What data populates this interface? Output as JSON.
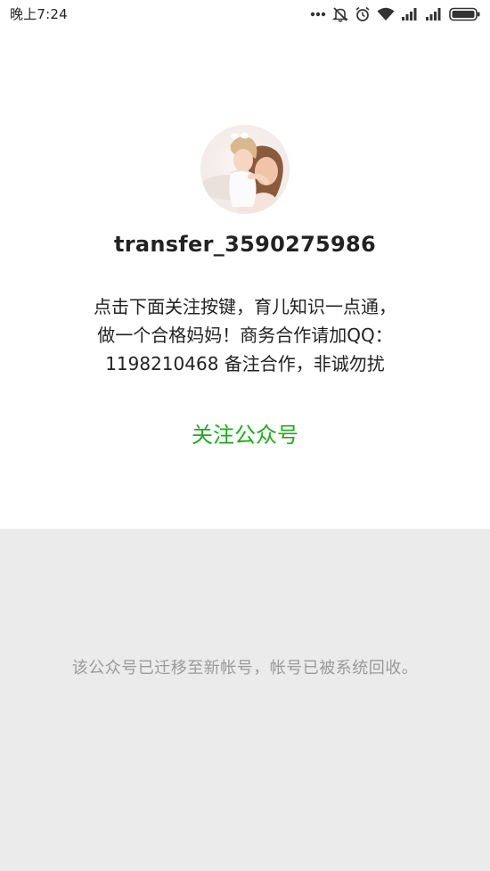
{
  "status_bar": {
    "time": "晚上7:24",
    "icons": [
      "more-dots-icon",
      "mute-icon",
      "alarm-icon",
      "wifi-icon",
      "signal-icon",
      "signal-icon",
      "battery-icon"
    ]
  },
  "nav": {
    "back_icon": "chevron-left-icon"
  },
  "profile": {
    "avatar": "mother-and-child-photo",
    "name": "transfer_3590275986",
    "description_lines": [
      "点击下面关注按键，育儿知识一点通，",
      "做一个合格妈妈！商务合作请加QQ：",
      "1198210468 备注合作，非诚勿扰"
    ],
    "follow_label": "关注公众号"
  },
  "notice": {
    "text": "该公众号已迁移至新帐号，帐号已被系统回收。"
  },
  "colors": {
    "accent_green": "#1aad19",
    "notice_bg": "#ebebeb",
    "notice_text": "#9a9a9a"
  }
}
